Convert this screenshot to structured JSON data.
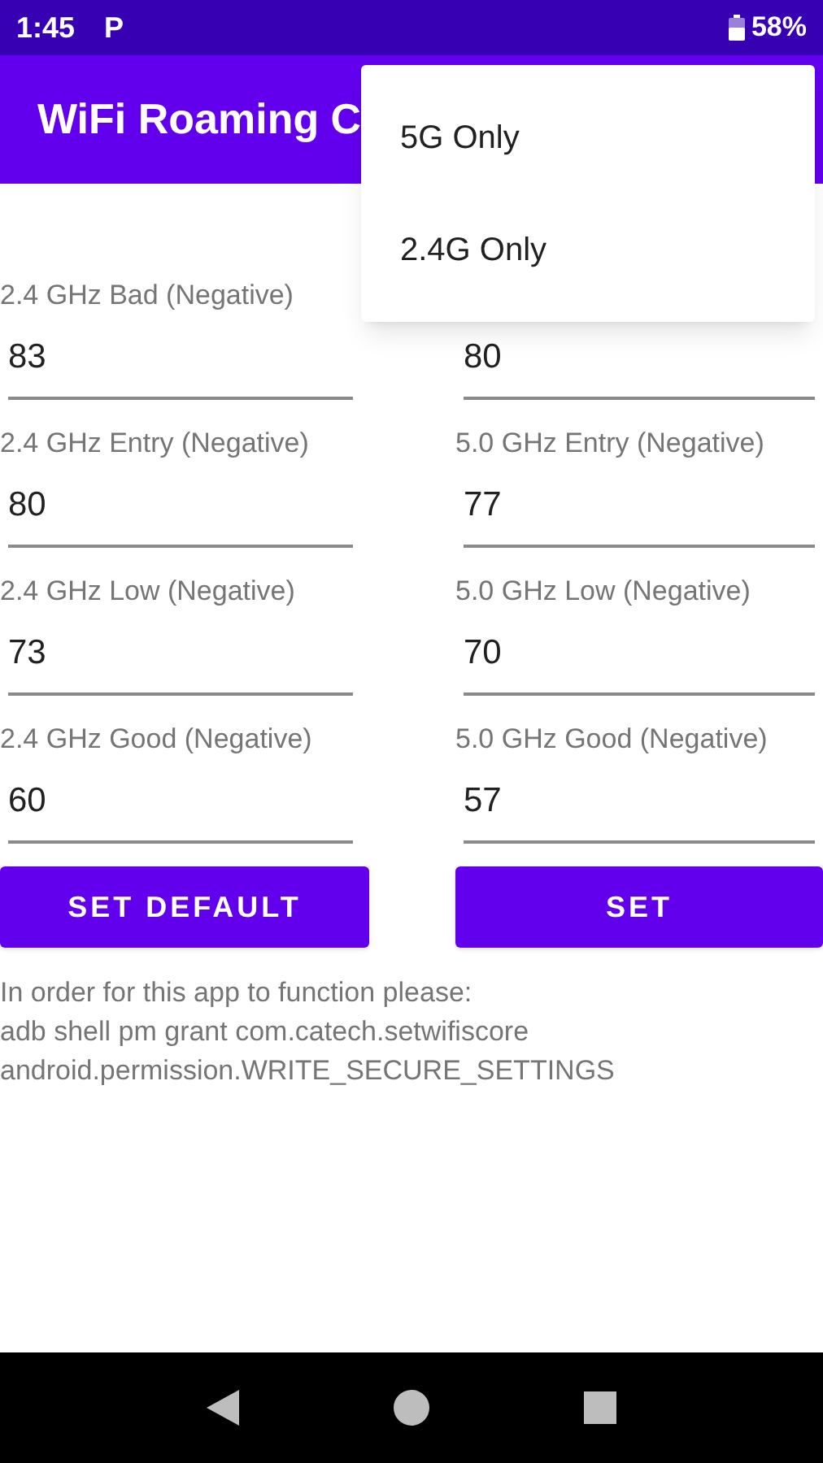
{
  "status_bar": {
    "time": "1:45",
    "notification": "P",
    "battery": "58%"
  },
  "app_bar": {
    "title": "WiFi Roaming C"
  },
  "menu": [
    {
      "label": "5G Only"
    },
    {
      "label": "2.4G Only"
    }
  ],
  "fields": [
    {
      "left_label": "2.4 GHz Bad (Negative)",
      "left_value": "83",
      "right_value": "80"
    },
    {
      "left_label": "2.4 GHz Entry (Negative)",
      "left_value": "80",
      "right_label": "5.0 GHz Entry (Negative)",
      "right_value": "77"
    },
    {
      "left_label": "2.4 GHz Low (Negative)",
      "left_value": "73",
      "right_label": "5.0 GHz Low (Negative)",
      "right_value": "70"
    },
    {
      "left_label": "2.4 GHz Good (Negative)",
      "left_value": "60",
      "right_label": "5.0 GHz Good (Negative)",
      "right_value": "57"
    }
  ],
  "buttons": [
    {
      "label": "SET DEFAULT"
    },
    {
      "label": "SET"
    }
  ],
  "instructions": [
    "In order for this app to function please:",
    "adb shell pm grant com.catech.setwifiscore",
    "android.permission.WRITE_SECURE_SETTINGS"
  ]
}
